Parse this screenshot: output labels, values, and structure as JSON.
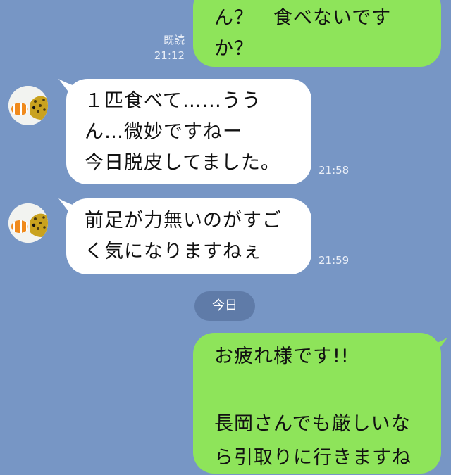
{
  "chat": {
    "messages": [
      {
        "side": "out",
        "lines": [
          "ん？　食べないです",
          "か？"
        ],
        "read_label": "既読",
        "time": "21:12"
      },
      {
        "side": "in",
        "lines": [
          "１匹食べて……うう",
          "ん…微妙ですねー",
          "今日脱皮してました。"
        ],
        "time": "21:58"
      },
      {
        "side": "in",
        "lines": [
          "前足が力無いのがすご",
          "く気になりますねぇ"
        ],
        "time": "21:59"
      },
      {
        "side": "out",
        "lines": [
          "お疲れ様です!!",
          "",
          "長岡さんでも厳しいな",
          "ら引取りに行きますね"
        ]
      }
    ],
    "date_separator": "今日"
  },
  "colors": {
    "background": "#7796c5",
    "outgoing_bubble": "#8ee45a",
    "incoming_bubble": "#ffffff",
    "date_pill": "#5f7ba8"
  },
  "icons": {
    "avatar": "gecko-fish-avatar-icon"
  }
}
